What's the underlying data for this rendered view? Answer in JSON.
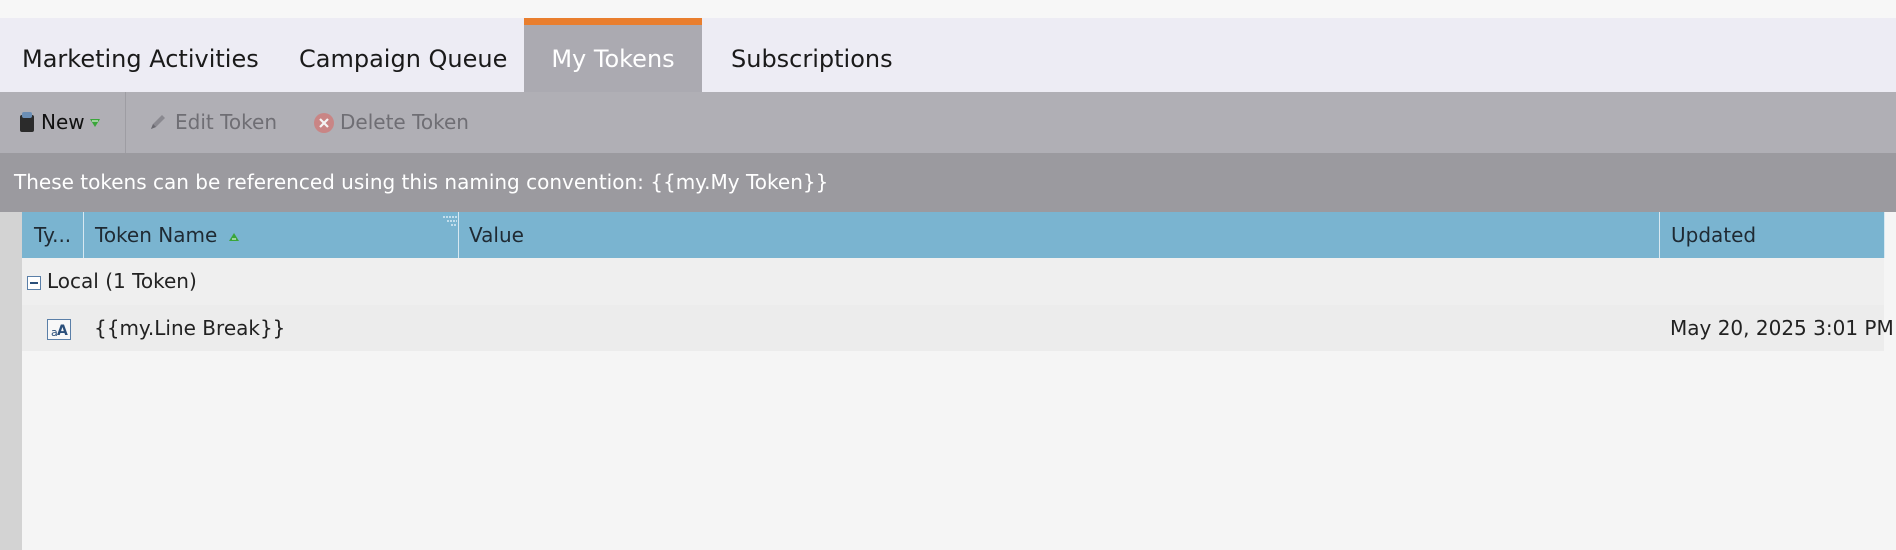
{
  "tabs": [
    {
      "label": "Marketing Activities",
      "active": false
    },
    {
      "label": "Campaign Queue",
      "active": false
    },
    {
      "label": "My Tokens",
      "active": true
    },
    {
      "label": "Subscriptions",
      "active": false
    }
  ],
  "toolbar": {
    "new_label": "New",
    "edit_label": "Edit Token",
    "delete_label": "Delete Token"
  },
  "info_text": "These tokens can be referenced using this naming convention: {{my.My Token}}",
  "grid": {
    "columns": {
      "type": "Ty...",
      "token_name": "Token Name",
      "value": "Value",
      "updated": "Updated"
    },
    "sort": {
      "column": "Token Name",
      "direction": "ascending"
    },
    "groups": [
      {
        "label": "Local (1 Token)",
        "expanded": true,
        "rows": [
          {
            "type_icon": "text-token-icon",
            "token_name": "{{my.Line Break}}",
            "value": "",
            "updated": "May 20, 2025 3:01 PM"
          }
        ]
      }
    ]
  },
  "colors": {
    "accent": "#e97e2e",
    "tab_bar": "#edecf4",
    "active_tab": "#abaab1",
    "toolbar": "#b0afb5",
    "info_bar": "#9b9a9f",
    "grid_header": "#7ab4d0",
    "sort_arrow": "#3aa63a"
  }
}
